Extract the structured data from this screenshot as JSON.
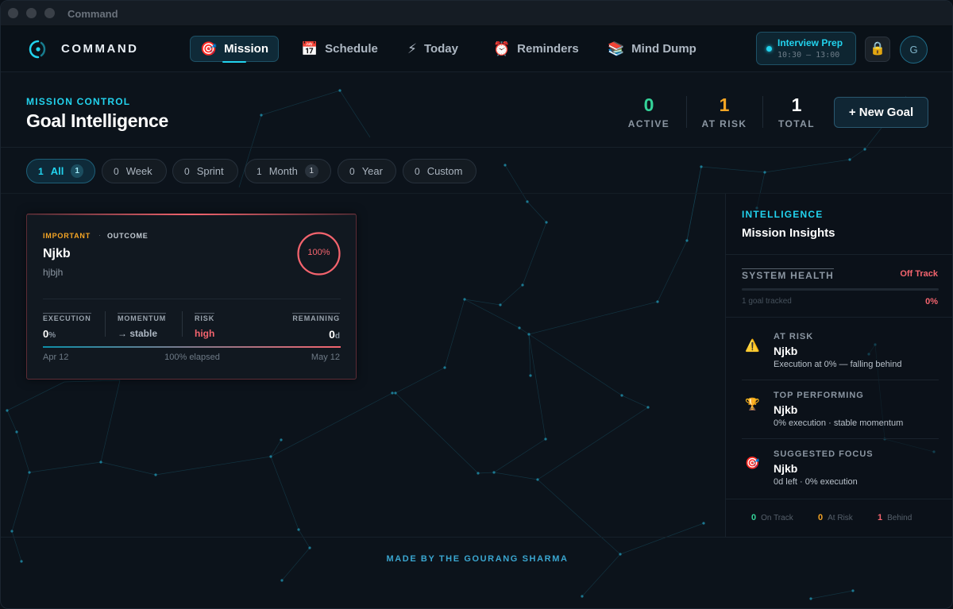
{
  "window": {
    "title": "Command"
  },
  "brand": {
    "name": "COMMAND"
  },
  "nav": [
    {
      "label": "Mission",
      "icon": "🎯",
      "active": true
    },
    {
      "label": "Schedule",
      "icon": "📅",
      "active": false
    },
    {
      "label": "Today",
      "icon": "⚡",
      "active": false
    },
    {
      "label": "Reminders",
      "icon": "⏰",
      "active": false
    },
    {
      "label": "Mind Dump",
      "icon": "📚",
      "active": false
    }
  ],
  "focus": {
    "title": "Interview Prep",
    "time": "10:30 – 13:00"
  },
  "user": {
    "initial": "G",
    "lock_icon": "🔒"
  },
  "page": {
    "eyebrow": "MISSION CONTROL",
    "title": "Goal Intelligence",
    "new_goal_label": "+ New Goal"
  },
  "stats": [
    {
      "value": "0",
      "label": "ACTIVE",
      "color": "#34d399"
    },
    {
      "value": "1",
      "label": "AT RISK",
      "color": "#f5a524"
    },
    {
      "value": "1",
      "label": "TOTAL",
      "color": "#ffffff"
    }
  ],
  "filters": [
    {
      "count": "1",
      "label": "All",
      "badge": "1",
      "active": true
    },
    {
      "count": "0",
      "label": "Week",
      "badge": "",
      "active": false
    },
    {
      "count": "0",
      "label": "Sprint",
      "badge": "",
      "active": false
    },
    {
      "count": "1",
      "label": "Month",
      "badge": "1",
      "active": false
    },
    {
      "count": "0",
      "label": "Year",
      "badge": "",
      "active": false
    },
    {
      "count": "0",
      "label": "Custom",
      "badge": "",
      "active": false
    }
  ],
  "goal": {
    "priority": "IMPORTANT",
    "separator": "·",
    "type": "OUTCOME",
    "title": "Njkb",
    "description": "hjbjh",
    "ring_percent": 100,
    "ring_label": "100%",
    "execution_label": "EXECUTION",
    "execution_value": "0",
    "execution_unit": "%",
    "momentum_label": "MOMENTUM",
    "momentum_value": "→ stable",
    "risk_label": "RISK",
    "risk_value": "high",
    "remaining_label": "REMAINING",
    "remaining_value": "0",
    "remaining_unit": "d",
    "elapsed_fraction": 1.0,
    "start_date": "Apr 12",
    "elapsed_text": "100% elapsed",
    "end_date": "May 12"
  },
  "insights": {
    "eyebrow": "INTELLIGENCE",
    "title": "Mission Insights",
    "health_label": "SYSTEM HEALTH",
    "health_status": "Off Track",
    "health_sub": "1 goal tracked",
    "health_pct": "0%",
    "health_fraction": 0,
    "items": [
      {
        "icon": "⚠️",
        "label": "AT RISK",
        "name": "Njkb",
        "desc": "Execution at 0% — falling behind"
      },
      {
        "icon": "🏆",
        "label": "TOP PERFORMING",
        "name": "Njkb",
        "desc": "0% execution · stable momentum"
      },
      {
        "icon": "🎯",
        "label": "SUGGESTED FOCUS",
        "name": "Njkb",
        "desc": "0d left · 0% execution"
      }
    ],
    "legend": [
      {
        "count": "0",
        "label": "On Track",
        "color": "#34d399"
      },
      {
        "count": "0",
        "label": "At Risk",
        "color": "#f5a524"
      },
      {
        "count": "1",
        "label": "Behind",
        "color": "#f4646e"
      }
    ]
  },
  "footer": {
    "credit": "MADE BY THE GOURANG SHARMA"
  },
  "colors": {
    "accent": "#22d3ee",
    "danger": "#f4646e",
    "warning": "#f5a524",
    "success": "#34d399"
  }
}
